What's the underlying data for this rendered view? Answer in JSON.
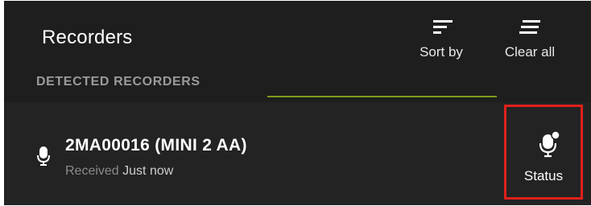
{
  "header": {
    "title": "Recorders",
    "sort_label": "Sort by",
    "sort_icon": "sort-lines-icon",
    "clear_label": "Clear all",
    "clear_icon": "clear-lines-icon"
  },
  "section": {
    "label": "DETECTED RECORDERS"
  },
  "recorders": [
    {
      "icon": "microphone-icon",
      "name": "2MA00016 (MINI 2 AA)",
      "status_prefix": "Received",
      "status_value": "Just now",
      "action_label": "Status",
      "action_icon": "microphone-status-icon"
    }
  ],
  "colors": {
    "background": "#1f1f1f",
    "accent_underline": "#7f9b1a",
    "highlight_border": "#e0201c",
    "text_primary": "#ffffff",
    "text_muted": "#8a8a8a"
  }
}
